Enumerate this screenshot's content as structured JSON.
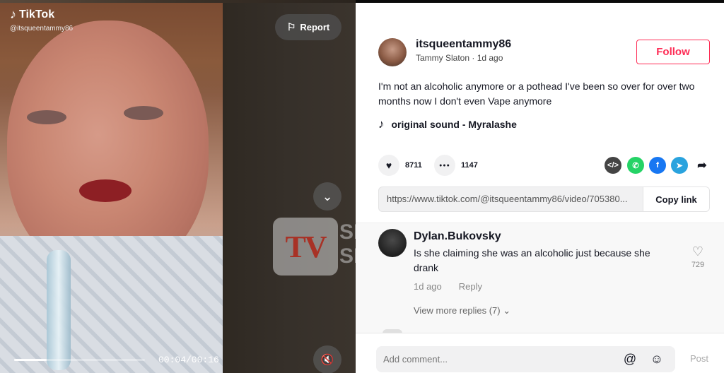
{
  "video": {
    "brand": "TikTok",
    "handle": "@itsqueentammy86",
    "report_label": "Report",
    "time": "00:04/00:16",
    "progress_fraction": 0.25
  },
  "watermark": {
    "logo": "TV",
    "text_lines": [
      "SEASO",
      "SPOIL"
    ]
  },
  "author": {
    "username": "itsqueentammy86",
    "display_name": "Tammy Slaton",
    "separator": " · ",
    "posted": "1d ago",
    "follow_label": "Follow"
  },
  "post": {
    "caption": "I'm not an alcoholic anymore or a pothead I've been so over for over two months now I don't even Vape anymore",
    "sound": "original sound - Myralashe",
    "likes": "8711",
    "comments": "1147",
    "link": "https://www.tiktok.com/@itsqueentammy86/video/705380...",
    "copy_label": "Copy link"
  },
  "comment": {
    "name": "Dylan.Bukovsky",
    "text": "Is she claiming she was an alcoholic just because she drank",
    "time": "1d ago",
    "reply_label": "Reply",
    "likes": "729",
    "view_replies": "View more replies (7)"
  },
  "composer": {
    "placeholder": "Add comment...",
    "post_label": "Post"
  },
  "icons": {
    "note": "♪",
    "flag": "⚐",
    "chevron_down": "⌄",
    "mute": "🔇",
    "heart": "♥",
    "heart_outline": "♡",
    "comment": "●●●",
    "at": "@",
    "emoji": "☺",
    "share": "➦"
  },
  "colors": {
    "accent": "#fe2c55",
    "whatsapp": "#25d366",
    "facebook": "#1877f2",
    "telegram": "#2aa3de"
  }
}
